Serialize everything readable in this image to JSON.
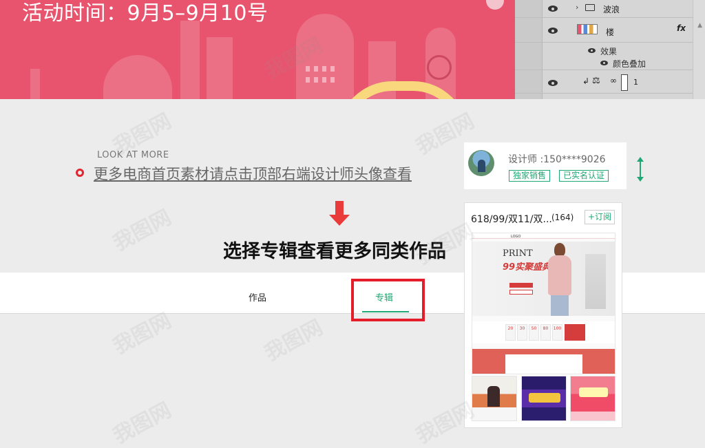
{
  "banner": {
    "title": "活动时间：9月5–9月10号"
  },
  "layers": {
    "rows": [
      {
        "name": "波浪"
      },
      {
        "name": "楼",
        "fx": "fx"
      },
      {
        "name": "效果"
      },
      {
        "name": "颜色叠加"
      },
      {
        "name": "1"
      }
    ]
  },
  "section": {
    "look_more": "LOOK AT MORE",
    "hint": "更多电商首页素材请点击顶部右端设计师头像查看",
    "big_title": "选择专辑查看更多同类作品"
  },
  "tabs": {
    "works": "作品",
    "albums": "专辑"
  },
  "designer": {
    "name": "设计师 :150****9026",
    "tag_exclusive": "独家销售",
    "tag_verified": "已实名认证"
  },
  "album": {
    "name": "618/99/双11/双...",
    "count": "(164)",
    "subscribe": "+订阅",
    "cover": {
      "logo": "LOGO",
      "print": "PRINT",
      "sale": "99实聚盛典",
      "coupons": [
        "20",
        "30",
        "50",
        "80",
        "100"
      ]
    }
  },
  "watermark": "我图网",
  "colors": {
    "banner": "#e8546e",
    "accent_green": "#1fa873",
    "highlight_red": "#e41d2a",
    "arrow_red": "#ea3b3b"
  }
}
